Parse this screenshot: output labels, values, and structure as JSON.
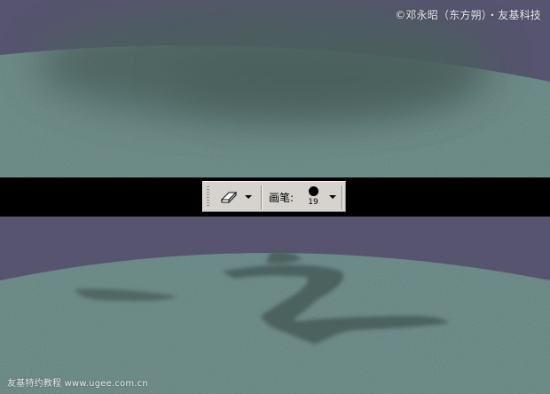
{
  "watermark_top": "©邓永昭（东方朔）・友基科技",
  "watermark_bottom": "友基特约教程 www.ugee.com.cn",
  "toolbar": {
    "tool_icon": "eraser-icon",
    "brush_label": "画笔:",
    "brush_size": "19"
  },
  "colors": {
    "sky": "#56546e",
    "surface": "#5f7f7b",
    "stain": "#4a5e5b",
    "toolbar_bg": "#d6d3ce"
  }
}
